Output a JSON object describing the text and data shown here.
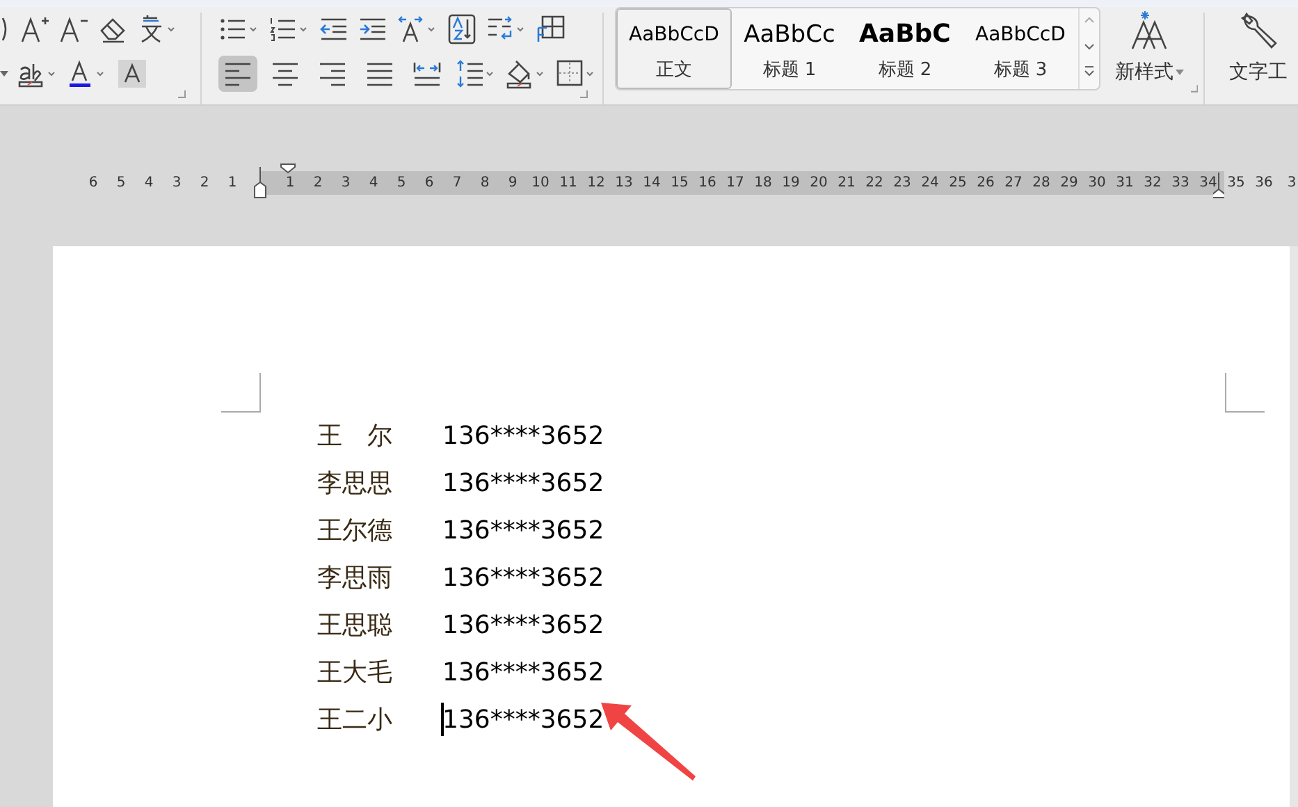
{
  "toolbar": {
    "alignment_buttons": [
      {
        "kind": "left",
        "selected": true
      },
      {
        "kind": "center",
        "selected": false
      },
      {
        "kind": "right",
        "selected": false
      },
      {
        "kind": "justify",
        "selected": false
      },
      {
        "kind": "distribute",
        "selected": false
      }
    ]
  },
  "style_gallery": {
    "items": [
      {
        "kind": "normal",
        "preview": "AaBbCcD",
        "label": "正文",
        "selected": true
      },
      {
        "kind": "heading1",
        "preview": "AaBbCc",
        "label": "标题 1",
        "selected": false
      },
      {
        "kind": "heading2",
        "preview": "AaBbC",
        "label": "标题 2",
        "selected": false
      },
      {
        "kind": "heading3",
        "preview": "AaBbCcD",
        "label": "标题 3",
        "selected": false
      }
    ]
  },
  "new_style_button": {
    "label": "新样式"
  },
  "text_tools_button": {
    "label": "文字工"
  },
  "ruler": {
    "left_numbers": [
      "6",
      "5",
      "4",
      "3",
      "2",
      "1"
    ],
    "right_numbers": [
      "1",
      "2",
      "3",
      "4",
      "5",
      "6",
      "7",
      "8",
      "9",
      "10",
      "11",
      "12",
      "13",
      "14",
      "15",
      "16",
      "17",
      "18",
      "19",
      "20",
      "21",
      "22",
      "23",
      "24",
      "25",
      "26",
      "27",
      "28",
      "29",
      "30",
      "31",
      "32",
      "33",
      "34",
      "35",
      "36",
      "3"
    ]
  },
  "document": {
    "rows": [
      {
        "name": "王　尔",
        "phone": "136****3652",
        "cursor": false
      },
      {
        "name": "李思思",
        "phone": "136****3652",
        "cursor": false
      },
      {
        "name": "王尔德",
        "phone": "136****3652",
        "cursor": false
      },
      {
        "name": "李思雨",
        "phone": "136****3652",
        "cursor": false
      },
      {
        "name": "王思聪",
        "phone": "136****3652",
        "cursor": false
      },
      {
        "name": "王大毛",
        "phone": "136****3652",
        "cursor": false
      },
      {
        "name": "王二小",
        "phone": "136****3652",
        "cursor": true
      }
    ]
  }
}
